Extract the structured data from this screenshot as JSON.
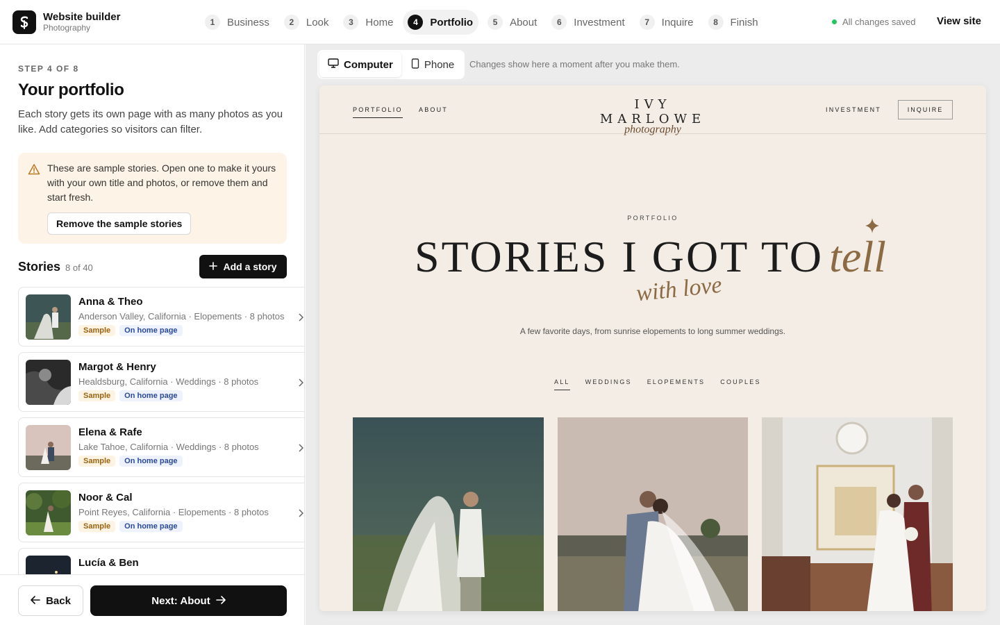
{
  "app": {
    "brand_title": "Website builder",
    "brand_subtitle": "Photography",
    "saved_status": "All changes saved",
    "view_site": "View site"
  },
  "steps": [
    {
      "num": "1",
      "label": "Business"
    },
    {
      "num": "2",
      "label": "Look"
    },
    {
      "num": "3",
      "label": "Home"
    },
    {
      "num": "4",
      "label": "Portfolio",
      "active": true
    },
    {
      "num": "5",
      "label": "About"
    },
    {
      "num": "6",
      "label": "Investment"
    },
    {
      "num": "7",
      "label": "Inquire"
    },
    {
      "num": "8",
      "label": "Finish"
    }
  ],
  "panel": {
    "step_label": "STEP 4 OF 8",
    "title": "Your portfolio",
    "description": "Each story gets its own page with as many photos as you like. Add categories so visitors can filter.",
    "notice_text": "These are sample stories. Open one to make it yours with your own title and photos, or remove them and start fresh.",
    "remove_button": "Remove the sample stories",
    "stories_heading": "Stories",
    "stories_count": "8 of 40",
    "add_story": "Add a story",
    "back": "Back",
    "next": "Next: About"
  },
  "stories": [
    {
      "name": "Anna & Theo",
      "meta": "Anderson Valley, California · Elopements · 8 photos",
      "tag_sample": "Sample",
      "tag_home": "On home page"
    },
    {
      "name": "Margot & Henry",
      "meta": "Healdsburg, California · Weddings · 8 photos",
      "tag_sample": "Sample",
      "tag_home": "On home page"
    },
    {
      "name": "Elena & Rafe",
      "meta": "Lake Tahoe, California · Weddings · 8 photos",
      "tag_sample": "Sample",
      "tag_home": "On home page"
    },
    {
      "name": "Noor & Cal",
      "meta": "Point Reyes, California · Elopements · 8 photos",
      "tag_sample": "Sample",
      "tag_home": "On home page"
    },
    {
      "name": "Lucía & Ben",
      "meta": "",
      "tag_sample": "",
      "tag_home": ""
    }
  ],
  "preview": {
    "device_computer": "Computer",
    "device_phone": "Phone",
    "hint": "Changes show here a moment after you make them.",
    "nav_portfolio": "PORTFOLIO",
    "nav_about": "ABOUT",
    "nav_investment": "INVESTMENT",
    "nav_inquire": "INQUIRE",
    "logo_line1": "IVY MARLOWE",
    "logo_line2": "photography",
    "eyebrow": "PORTFOLIO",
    "title_main": "STORIES I GOT TO",
    "title_accent": "tell",
    "title_script": "with love",
    "subtitle": "A few favorite days, from sunrise elopements to long summer weddings.",
    "filters": [
      "ALL",
      "WEDDINGS",
      "ELOPEMENTS",
      "COUPLES"
    ]
  },
  "colors": {
    "accent": "#111111",
    "site_background": "#f3ede5",
    "site_accent": "#8b6a44",
    "notice_background": "#fdf3e6",
    "saved_dot": "#22c55e"
  }
}
